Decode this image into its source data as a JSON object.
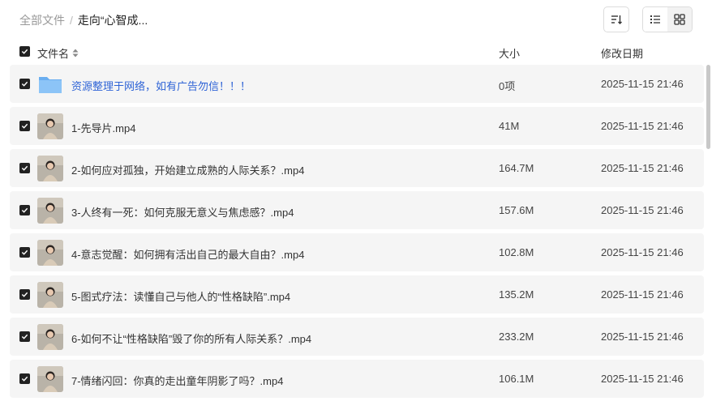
{
  "breadcrumb": {
    "root": "全部文件",
    "separator": "/",
    "current": "走向“心智成..."
  },
  "toolbar": {
    "sort_icon": "sort-icon",
    "list_view_icon": "list-view-icon",
    "grid_view_icon": "grid-view-icon"
  },
  "columns": {
    "name": "文件名",
    "size": "大小",
    "date": "修改日期"
  },
  "files": [
    {
      "name": "资源整理于网络，如有广告勿信！！！",
      "size": "0项",
      "date": "2025-11-15 21:46",
      "type": "folder"
    },
    {
      "name": "1-先导片.mp4",
      "size": "41M",
      "date": "2025-11-15 21:46",
      "type": "video"
    },
    {
      "name": "2-如何应对孤独，开始建立成熟的人际关系？.mp4",
      "size": "164.7M",
      "date": "2025-11-15 21:46",
      "type": "video"
    },
    {
      "name": "3-人终有一死：如何克服无意义与焦虑感？.mp4",
      "size": "157.6M",
      "date": "2025-11-15 21:46",
      "type": "video"
    },
    {
      "name": "4-意志觉醒：如何拥有活出自己的最大自由？.mp4",
      "size": "102.8M",
      "date": "2025-11-15 21:46",
      "type": "video"
    },
    {
      "name": "5-图式疗法：读懂自己与他人的“性格缺陷”.mp4",
      "size": "135.2M",
      "date": "2025-11-15 21:46",
      "type": "video"
    },
    {
      "name": "6-如何不让“性格缺陷”毁了你的所有人际关系？.mp4",
      "size": "233.2M",
      "date": "2025-11-15 21:46",
      "type": "video"
    },
    {
      "name": "7-情绪闪回：你真的走出童年阴影了吗？.mp4",
      "size": "106.1M",
      "date": "2025-11-15 21:46",
      "type": "video"
    }
  ],
  "colors": {
    "folder_link": "#2f64d6",
    "row_bg": "#f5f5f5",
    "checkbox": "#222222"
  }
}
